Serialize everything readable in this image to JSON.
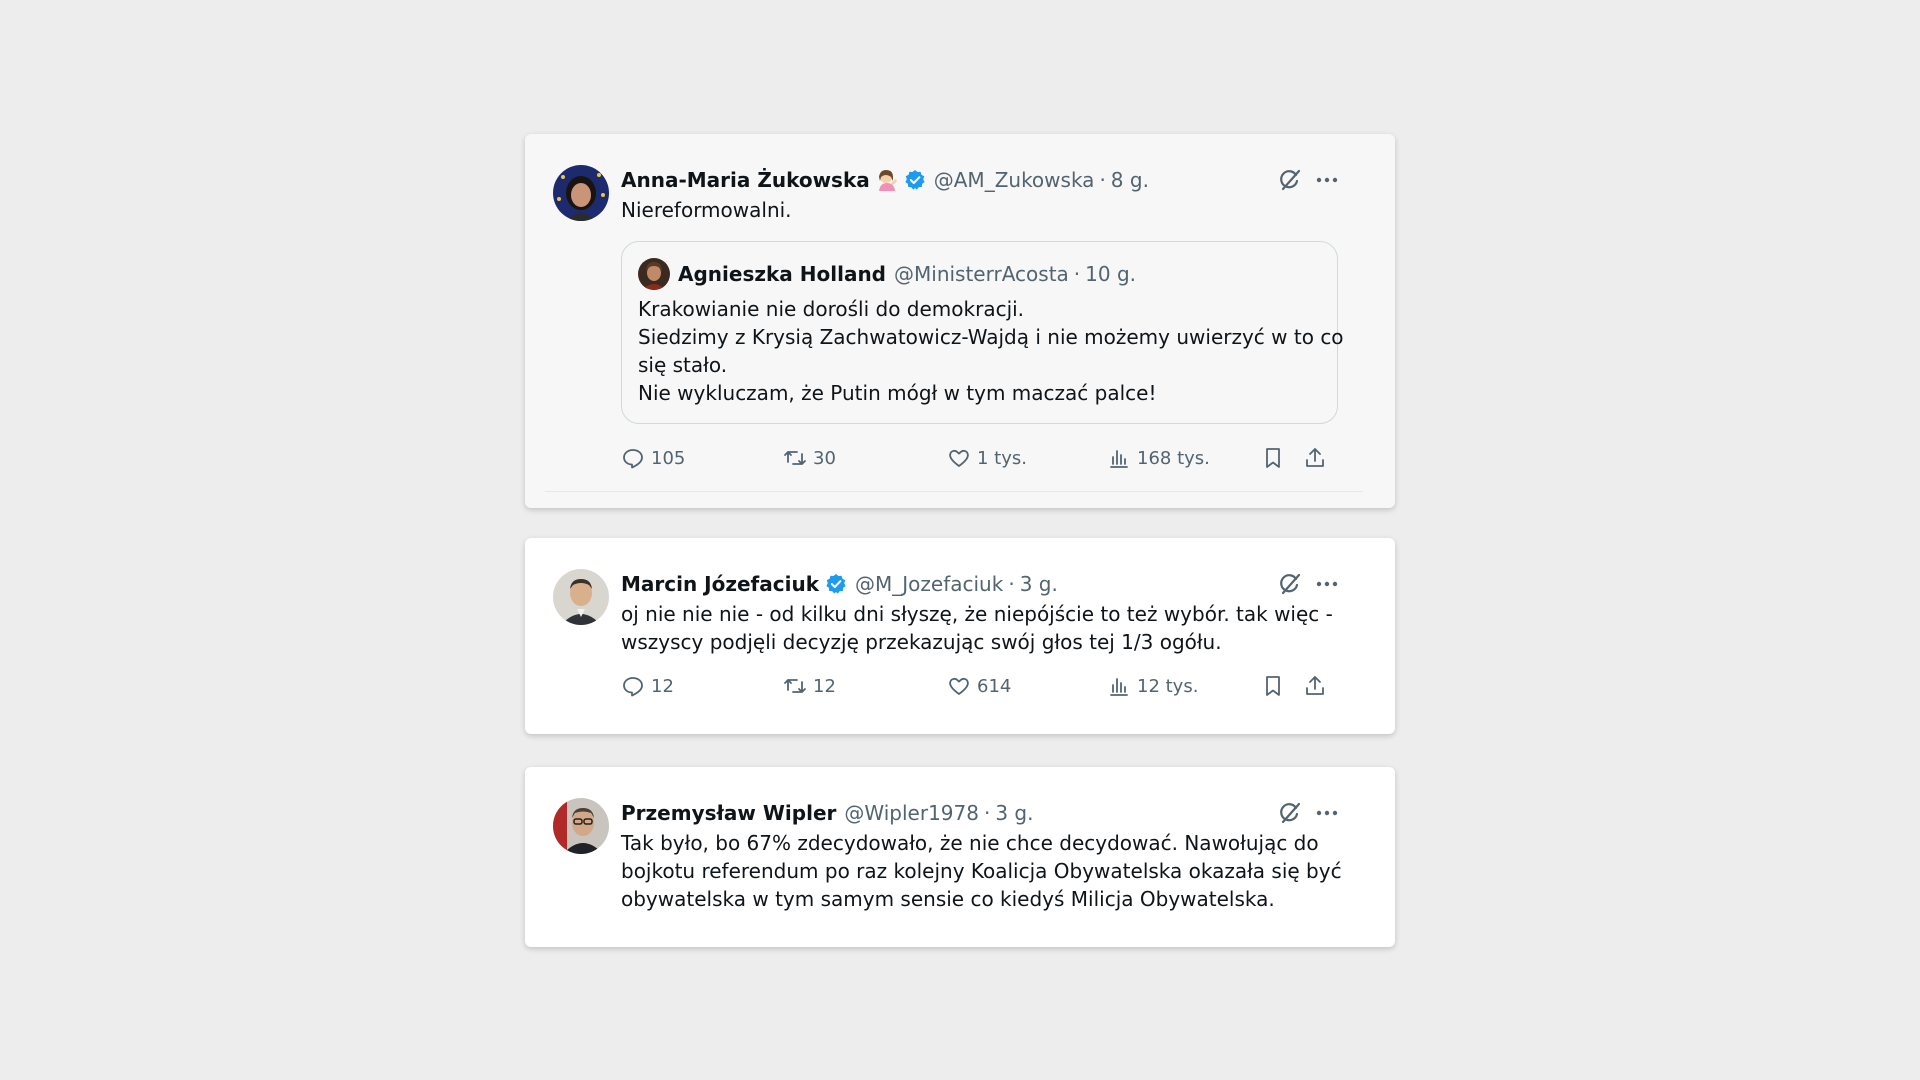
{
  "tweets": [
    {
      "name": "Anna-Maria Żukowska",
      "handle": "@AM_Zukowska",
      "dot": "·",
      "time": "8 g.",
      "verified": true,
      "lines": [
        "Niereformowalni."
      ],
      "quote": {
        "name": "Agnieszka Holland",
        "handle": "@MinisterrAcosta",
        "dot": "·",
        "time": "10 g.",
        "lines": [
          "Krakowianie nie dorośli do demokracji.",
          "Siedzimy z Krysią Zachwatowicz-Wajdą i nie możemy uwierzyć w to co",
          "się stało.",
          "Nie wykluczam, że Putin mógł w tym maczać palce!"
        ]
      },
      "stats": {
        "replies": "105",
        "retweets": "30",
        "likes": "1 tys.",
        "views": "168 tys."
      }
    },
    {
      "name": "Marcin Józefaciuk",
      "handle": "@M_Jozefaciuk",
      "dot": "·",
      "time": "3 g.",
      "verified": true,
      "lines": [
        "oj nie nie nie - od kilku dni słyszę, że niepójście to też wybór. tak więc -",
        "wszyscy podjęli decyzję przekazując swój głos tej 1/3 ogółu."
      ],
      "stats": {
        "replies": "12",
        "retweets": "12",
        "likes": "614",
        "views": "12 tys."
      }
    },
    {
      "name": "Przemysław Wipler",
      "handle": "@Wipler1978",
      "dot": "·",
      "time": "3 g.",
      "verified": false,
      "lines": [
        "Tak było, bo 67% zdecydowało, że nie chce decydować. Nawołując do",
        "bojkotu referendum po raz kolejny Koalicja Obywatelska okazała się być",
        "obywatelska w tym samym sensie co kiedyś Milicja Obywatelska."
      ]
    }
  ],
  "colors": {
    "background": "#ededed",
    "text": "#0f1419",
    "secondary": "#536471",
    "verified": "#1d9bf0",
    "border": "#cfd9de"
  },
  "icons": [
    "verified-badge-icon",
    "grok-icon",
    "more-icon",
    "reply-icon",
    "retweet-icon",
    "like-icon",
    "views-icon",
    "bookmark-icon",
    "share-icon",
    "woman-tipping-hand-emoji"
  ]
}
